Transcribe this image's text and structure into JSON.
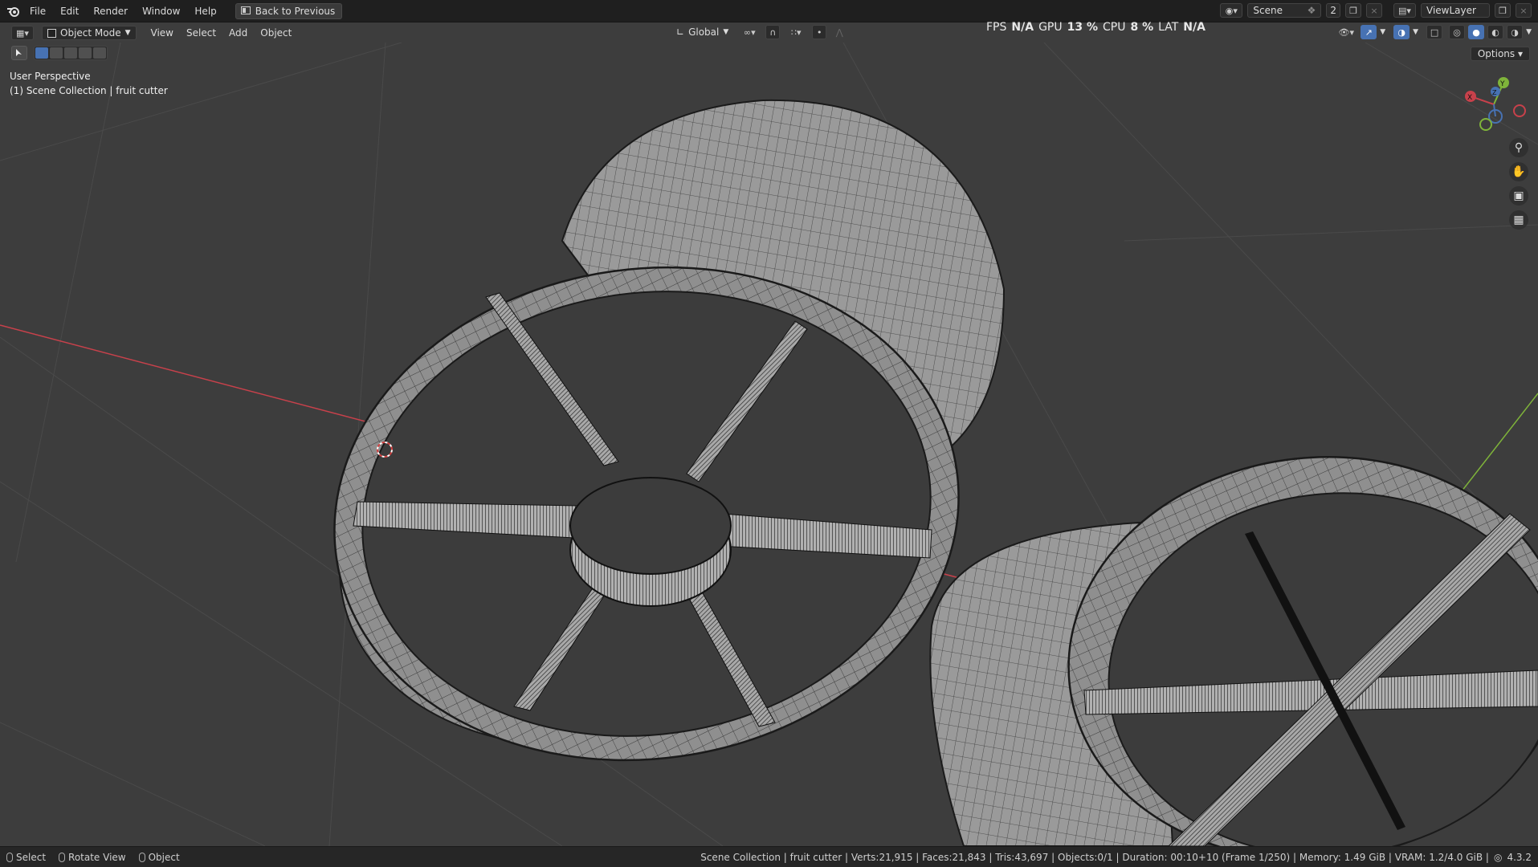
{
  "menu": {
    "file": "File",
    "edit": "Edit",
    "render": "Render",
    "window": "Window",
    "help": "Help",
    "back": "Back to Previous"
  },
  "stats": {
    "fps_label": "FPS",
    "fps_value": "N/A",
    "gpu_label": "GPU",
    "gpu_value": "13 %",
    "cpu_label": "CPU",
    "cpu_value": "8 %",
    "lat_label": "LAT",
    "lat_value": "N/A"
  },
  "top_right": {
    "scene": "Scene",
    "scene_users": "2",
    "view_layer": "ViewLayer"
  },
  "header": {
    "mode": "Object Mode",
    "view": "View",
    "select": "Select",
    "add": "Add",
    "object": "Object",
    "orientation": "Global",
    "options": "Options"
  },
  "viewport": {
    "perspective": "User Perspective",
    "collection": "(1) Scene Collection | fruit cutter",
    "gizmo_labels": {
      "x": "X",
      "y": "Y",
      "z": "Z"
    }
  },
  "statusbar": {
    "select": "Select",
    "rotate": "Rotate View",
    "object": "Object",
    "info": "Scene Collection | fruit cutter | Verts:21,915 | Faces:21,843 | Tris:43,697 | Objects:0/1 | Duration: 00:10+10 (Frame 1/250) | Memory: 1.49 GiB | VRAM: 1.2/4.0 GiB |",
    "version": "4.3.2"
  },
  "colors": {
    "x_axis": "#c8414b",
    "y_axis": "#7fb43a",
    "accent": "#4772b3",
    "background": "#3d3d3d"
  },
  "icons": [
    "blender-logo-icon",
    "back-icon",
    "editor-type-icon",
    "object-mode-icon",
    "orientation-icon",
    "pivot-icon",
    "snap-icon",
    "proportional-icon",
    "visibility-icon",
    "gizmo-icon",
    "overlay-icon",
    "xray-icon",
    "wireframe-shading-icon",
    "solid-shading-icon",
    "material-shading-icon",
    "rendered-shading-icon",
    "zoom-icon",
    "pan-hand-icon",
    "camera-view-icon",
    "grid-view-icon",
    "mouse-icon",
    "new-scene-icon",
    "new-layer-icon"
  ]
}
